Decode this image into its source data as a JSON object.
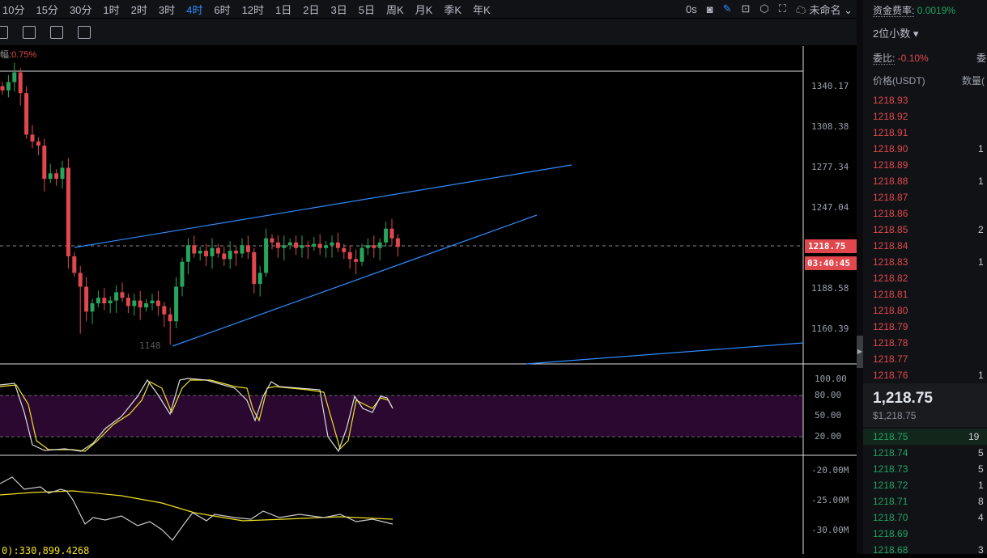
{
  "toolbar": {
    "intervals": [
      "10分",
      "15分",
      "30分",
      "1时",
      "2时",
      "3时",
      "4时",
      "6时",
      "12时",
      "1日",
      "2日",
      "3日",
      "5日",
      "周K",
      "月K",
      "季K",
      "年K"
    ],
    "active": "4时",
    "countdown": "0s",
    "layout_name": "未命名"
  },
  "chart": {
    "change_label": "幅:",
    "change_value": "0.75%",
    "price_ticks": [
      "1340.17",
      "1308.38",
      "1277.34",
      "1247.04",
      "1188.58",
      "1160.39"
    ],
    "current_price": "1218.75",
    "timer": "03:40:45",
    "low_marker": "1148",
    "stoch_ticks": [
      "100.00",
      "80.00",
      "50.00",
      "20.00"
    ],
    "vol_ticks": [
      "-20.00M",
      "-25.00M",
      "-30.00M"
    ],
    "bottom_readout": "0):330,899.4268",
    "closes": [
      1332,
      1338,
      1345,
      1330,
      1300,
      1295,
      1292,
      1268,
      1272,
      1268,
      1276,
      1212,
      1200,
      1190,
      1172,
      1178,
      1182,
      1178,
      1180,
      1186,
      1182,
      1176,
      1180,
      1175,
      1178,
      1180,
      1176,
      1170,
      1165,
      1190,
      1208,
      1220,
      1214,
      1216,
      1212,
      1218,
      1214,
      1210,
      1216,
      1214,
      1220,
      1215,
      1192,
      1200,
      1225,
      1222,
      1218,
      1220,
      1222,
      1218,
      1220,
      1219,
      1221,
      1218,
      1220,
      1222,
      1218,
      1215,
      1210,
      1208,
      1218,
      1220,
      1218,
      1222,
      1232,
      1225,
      1218.75
    ]
  },
  "sidebar": {
    "funding_label": "资金费率:",
    "funding_value": "0.0019%",
    "decimals": "2位小数",
    "ratio_label": "委比:",
    "ratio_value": "-0.10%",
    "ratio_label2": "委",
    "col_price": "价格(USDT)",
    "col_qty": "数量(",
    "asks": [
      {
        "p": "1218.93",
        "q": ""
      },
      {
        "p": "1218.92",
        "q": ""
      },
      {
        "p": "1218.91",
        "q": ""
      },
      {
        "p": "1218.90",
        "q": "1"
      },
      {
        "p": "1218.89",
        "q": ""
      },
      {
        "p": "1218.88",
        "q": "1"
      },
      {
        "p": "1218.87",
        "q": ""
      },
      {
        "p": "1218.86",
        "q": ""
      },
      {
        "p": "1218.85",
        "q": "2"
      },
      {
        "p": "1218.84",
        "q": ""
      },
      {
        "p": "1218.83",
        "q": "1"
      },
      {
        "p": "1218.82",
        "q": ""
      },
      {
        "p": "1218.81",
        "q": ""
      },
      {
        "p": "1218.80",
        "q": ""
      },
      {
        "p": "1218.79",
        "q": ""
      },
      {
        "p": "1218.78",
        "q": ""
      },
      {
        "p": "1218.77",
        "q": ""
      },
      {
        "p": "1218.76",
        "q": "1"
      }
    ],
    "last_price": "1,218.75",
    "last_usd": "$1,218.75",
    "bids": [
      {
        "p": "1218.75",
        "q": "19"
      },
      {
        "p": "1218.74",
        "q": "5"
      },
      {
        "p": "1218.73",
        "q": "5"
      },
      {
        "p": "1218.72",
        "q": "1"
      },
      {
        "p": "1218.71",
        "q": "8"
      },
      {
        "p": "1218.70",
        "q": "4"
      },
      {
        "p": "1218.69",
        "q": ""
      },
      {
        "p": "1218.68",
        "q": "3"
      }
    ]
  },
  "colors": {
    "up": "#26a65b",
    "down": "#e0484d",
    "trend": "#2f8cff",
    "stoch_band": "#2a0830"
  }
}
